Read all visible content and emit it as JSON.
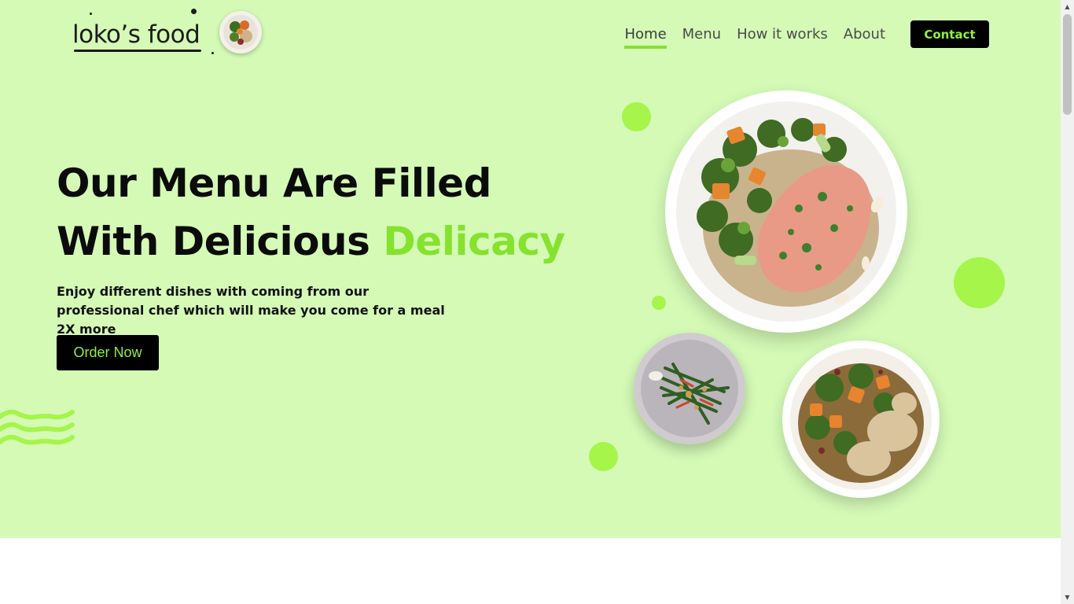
{
  "brand": {
    "name": "loko’s food",
    "icon": "food-plate-logo"
  },
  "nav": {
    "items": [
      "Home",
      "Menu",
      "How it works",
      "About"
    ],
    "active_index": 0,
    "contact_label": "Contact"
  },
  "hero": {
    "headline_line1": "Our Menu Are Filled",
    "headline_line2_plain": "With Delicious ",
    "headline_line2_accent": "Delicacy",
    "subtitle": "Enjoy different dishes with coming from our professional chef which will make you come for a meal 2X more",
    "cta_label": "Order Now",
    "images": [
      "salmon-quinoa-broccoli-plate",
      "green-beans-plate",
      "chicken-vegetables-plate"
    ]
  },
  "colors": {
    "hero_background": "#d4fab6",
    "accent": "#86e22d",
    "blob": "#a6f54a",
    "button": "#000000",
    "button_text": "#8ff23d",
    "text": "#0b0b0b"
  },
  "icons": {
    "wave": "wave-decoration-icon",
    "scroll_up": "chevron-up-icon",
    "scroll_down": "chevron-down-icon"
  }
}
